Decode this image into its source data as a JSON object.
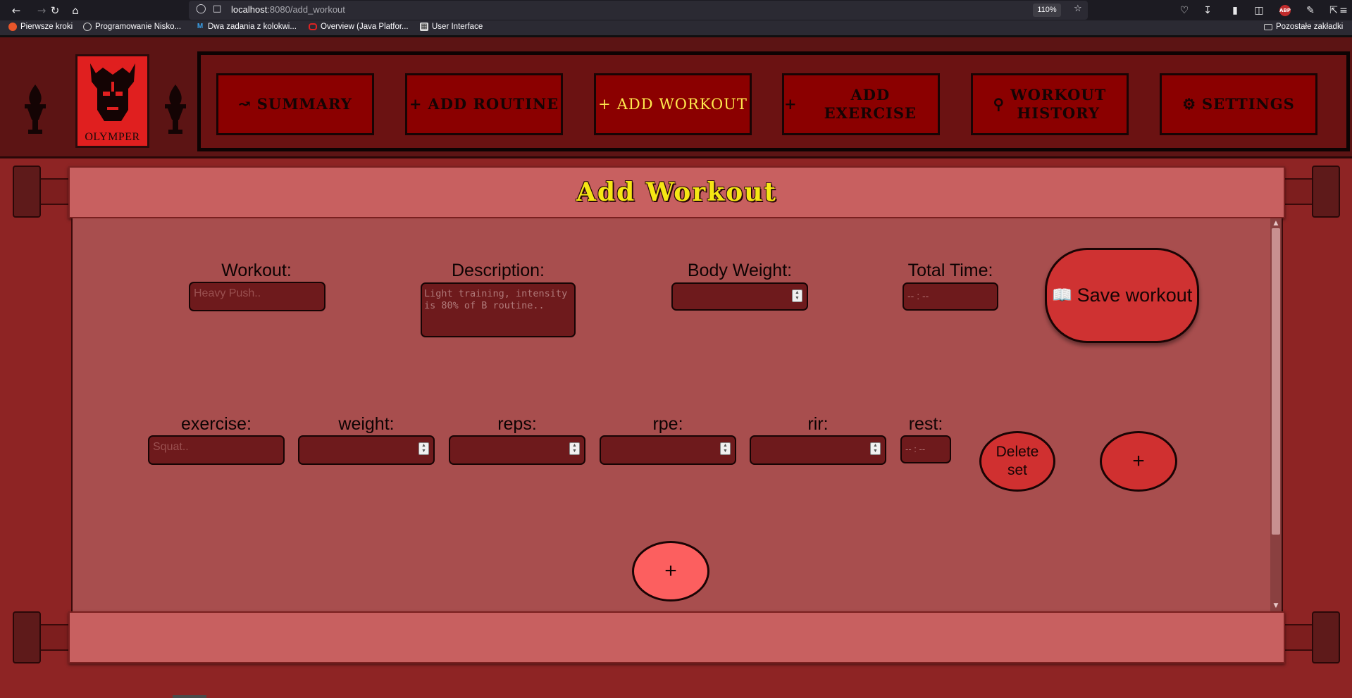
{
  "browser": {
    "url_host": "localhost",
    "url_path": ":8080/add_workout",
    "zoom": "110%",
    "abp_label": "ABP",
    "bookmarks": [
      {
        "label": "Pierwsze kroki",
        "icon": "firefox-icon"
      },
      {
        "label": "Programowanie Nisko...",
        "icon": "globe-icon"
      },
      {
        "label": "Dwa zadania z kolokwi...",
        "icon": "m-icon"
      },
      {
        "label": "Overview (Java Platfor...",
        "icon": "oracle-icon"
      },
      {
        "label": "User Interface",
        "icon": "ui-icon"
      }
    ],
    "other_bookmarks": "Pozostałe zakładki"
  },
  "app": {
    "logo_text": "OLYMPER",
    "nav": [
      {
        "label": "SUMMARY",
        "icon": "chart-line-icon",
        "active": false
      },
      {
        "label": "ADD ROUTINE",
        "icon": "plus-icon",
        "active": false
      },
      {
        "label": "ADD WORKOUT",
        "icon": "plus-icon",
        "active": true
      },
      {
        "label": "ADD EXERCISE",
        "icon": "plus-icon",
        "active": false
      },
      {
        "label": "WORKOUT HISTORY",
        "icon": "search-icon",
        "active": false
      },
      {
        "label": "SETTINGS",
        "icon": "gear-icon",
        "active": false
      }
    ],
    "page_title": "Add Workout"
  },
  "form": {
    "workout_label": "Workout:",
    "workout_placeholder": "Heavy Push..",
    "description_label": "Description:",
    "description_placeholder": "Light training, intensity is 80% of B routine..",
    "body_weight_label": "Body Weight:",
    "body_weight_value": "",
    "total_time_label": "Total Time:",
    "total_time_placeholder": "-- : --",
    "save_label": "Save workout"
  },
  "set_row": {
    "exercise_label": "exercise:",
    "exercise_placeholder": "Squat..",
    "weight_label": "weight:",
    "reps_label": "reps:",
    "rpe_label": "rpe:",
    "rir_label": "rir:",
    "rest_label": "rest:",
    "rest_placeholder": "-- : --",
    "delete_label": "Delete set",
    "add_set_label": "+"
  },
  "add_exercise_label": "+",
  "colors": {
    "accent_red": "#d03030",
    "title_yellow": "#f5e614",
    "panel": "#a84e4e",
    "banner": "#c86060"
  }
}
